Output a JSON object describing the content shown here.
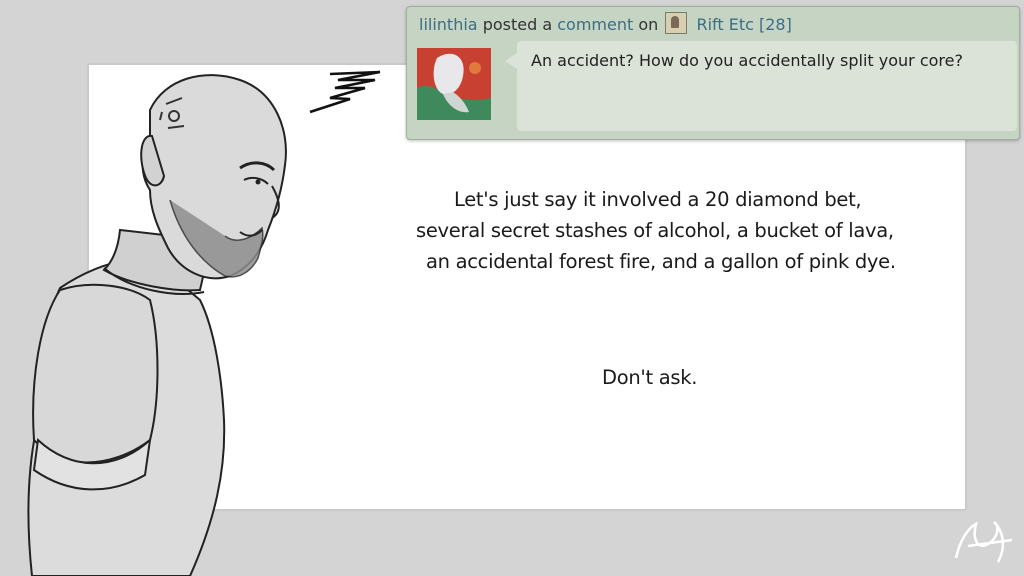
{
  "comic": {
    "dialogue": [
      "Let's just say it involved a 20 diamond bet,",
      "several secret stashes of alcohol, a bucket of lava,",
      "an accidental forest fire, and a gallon of pink dye."
    ],
    "aside": "Don't ask."
  },
  "notification": {
    "username": "lilinthia",
    "posted_text": "posted a",
    "comment_link": "comment",
    "on_text": "on",
    "deviation_title": "Rift Etc [28]",
    "comment_body": "An accident?  How do you accidentally split your core?"
  },
  "colors": {
    "background": "#d4d4d4",
    "panel": "#ffffff",
    "notification_bg": "#c6d4c3",
    "link": "#3b6e85"
  }
}
